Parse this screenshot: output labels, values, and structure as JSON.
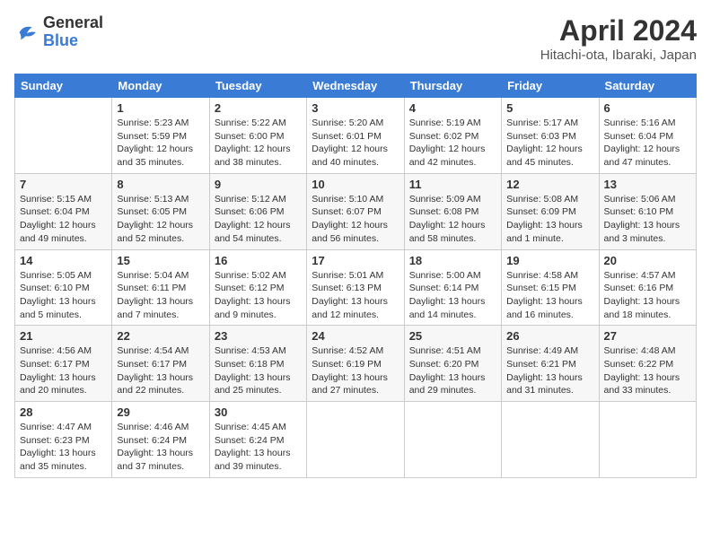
{
  "header": {
    "logo_general": "General",
    "logo_blue": "Blue",
    "main_title": "April 2024",
    "subtitle": "Hitachi-ota, Ibaraki, Japan"
  },
  "weekdays": [
    "Sunday",
    "Monday",
    "Tuesday",
    "Wednesday",
    "Thursday",
    "Friday",
    "Saturday"
  ],
  "weeks": [
    [
      {
        "day": "",
        "text": ""
      },
      {
        "day": "1",
        "text": "Sunrise: 5:23 AM\nSunset: 5:59 PM\nDaylight: 12 hours\nand 35 minutes."
      },
      {
        "day": "2",
        "text": "Sunrise: 5:22 AM\nSunset: 6:00 PM\nDaylight: 12 hours\nand 38 minutes."
      },
      {
        "day": "3",
        "text": "Sunrise: 5:20 AM\nSunset: 6:01 PM\nDaylight: 12 hours\nand 40 minutes."
      },
      {
        "day": "4",
        "text": "Sunrise: 5:19 AM\nSunset: 6:02 PM\nDaylight: 12 hours\nand 42 minutes."
      },
      {
        "day": "5",
        "text": "Sunrise: 5:17 AM\nSunset: 6:03 PM\nDaylight: 12 hours\nand 45 minutes."
      },
      {
        "day": "6",
        "text": "Sunrise: 5:16 AM\nSunset: 6:04 PM\nDaylight: 12 hours\nand 47 minutes."
      }
    ],
    [
      {
        "day": "7",
        "text": "Sunrise: 5:15 AM\nSunset: 6:04 PM\nDaylight: 12 hours\nand 49 minutes."
      },
      {
        "day": "8",
        "text": "Sunrise: 5:13 AM\nSunset: 6:05 PM\nDaylight: 12 hours\nand 52 minutes."
      },
      {
        "day": "9",
        "text": "Sunrise: 5:12 AM\nSunset: 6:06 PM\nDaylight: 12 hours\nand 54 minutes."
      },
      {
        "day": "10",
        "text": "Sunrise: 5:10 AM\nSunset: 6:07 PM\nDaylight: 12 hours\nand 56 minutes."
      },
      {
        "day": "11",
        "text": "Sunrise: 5:09 AM\nSunset: 6:08 PM\nDaylight: 12 hours\nand 58 minutes."
      },
      {
        "day": "12",
        "text": "Sunrise: 5:08 AM\nSunset: 6:09 PM\nDaylight: 13 hours\nand 1 minute."
      },
      {
        "day": "13",
        "text": "Sunrise: 5:06 AM\nSunset: 6:10 PM\nDaylight: 13 hours\nand 3 minutes."
      }
    ],
    [
      {
        "day": "14",
        "text": "Sunrise: 5:05 AM\nSunset: 6:10 PM\nDaylight: 13 hours\nand 5 minutes."
      },
      {
        "day": "15",
        "text": "Sunrise: 5:04 AM\nSunset: 6:11 PM\nDaylight: 13 hours\nand 7 minutes."
      },
      {
        "day": "16",
        "text": "Sunrise: 5:02 AM\nSunset: 6:12 PM\nDaylight: 13 hours\nand 9 minutes."
      },
      {
        "day": "17",
        "text": "Sunrise: 5:01 AM\nSunset: 6:13 PM\nDaylight: 13 hours\nand 12 minutes."
      },
      {
        "day": "18",
        "text": "Sunrise: 5:00 AM\nSunset: 6:14 PM\nDaylight: 13 hours\nand 14 minutes."
      },
      {
        "day": "19",
        "text": "Sunrise: 4:58 AM\nSunset: 6:15 PM\nDaylight: 13 hours\nand 16 minutes."
      },
      {
        "day": "20",
        "text": "Sunrise: 4:57 AM\nSunset: 6:16 PM\nDaylight: 13 hours\nand 18 minutes."
      }
    ],
    [
      {
        "day": "21",
        "text": "Sunrise: 4:56 AM\nSunset: 6:17 PM\nDaylight: 13 hours\nand 20 minutes."
      },
      {
        "day": "22",
        "text": "Sunrise: 4:54 AM\nSunset: 6:17 PM\nDaylight: 13 hours\nand 22 minutes."
      },
      {
        "day": "23",
        "text": "Sunrise: 4:53 AM\nSunset: 6:18 PM\nDaylight: 13 hours\nand 25 minutes."
      },
      {
        "day": "24",
        "text": "Sunrise: 4:52 AM\nSunset: 6:19 PM\nDaylight: 13 hours\nand 27 minutes."
      },
      {
        "day": "25",
        "text": "Sunrise: 4:51 AM\nSunset: 6:20 PM\nDaylight: 13 hours\nand 29 minutes."
      },
      {
        "day": "26",
        "text": "Sunrise: 4:49 AM\nSunset: 6:21 PM\nDaylight: 13 hours\nand 31 minutes."
      },
      {
        "day": "27",
        "text": "Sunrise: 4:48 AM\nSunset: 6:22 PM\nDaylight: 13 hours\nand 33 minutes."
      }
    ],
    [
      {
        "day": "28",
        "text": "Sunrise: 4:47 AM\nSunset: 6:23 PM\nDaylight: 13 hours\nand 35 minutes."
      },
      {
        "day": "29",
        "text": "Sunrise: 4:46 AM\nSunset: 6:24 PM\nDaylight: 13 hours\nand 37 minutes."
      },
      {
        "day": "30",
        "text": "Sunrise: 4:45 AM\nSunset: 6:24 PM\nDaylight: 13 hours\nand 39 minutes."
      },
      {
        "day": "",
        "text": ""
      },
      {
        "day": "",
        "text": ""
      },
      {
        "day": "",
        "text": ""
      },
      {
        "day": "",
        "text": ""
      }
    ]
  ]
}
